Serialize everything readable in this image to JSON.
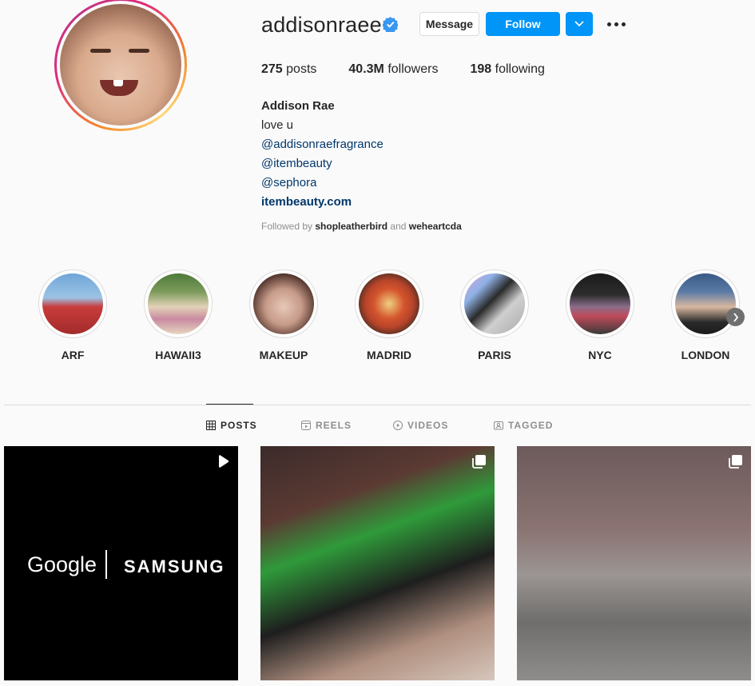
{
  "profile": {
    "username": "addisonraee",
    "verified": true,
    "message_label": "Message",
    "follow_label": "Follow",
    "stats": {
      "posts_count": "275",
      "posts_label": "posts",
      "followers_count": "40.3M",
      "followers_label": "followers",
      "following_count": "198",
      "following_label": "following"
    },
    "bio": {
      "name": "Addison Rae",
      "line1": "love u",
      "tag1": "@addisonraefragrance",
      "tag2": "@itembeauty",
      "tag3": "@sephora",
      "link": "itembeauty.com"
    },
    "followed_by": {
      "prefix": "Followed by",
      "user1": "shopleatherbird",
      "conj": "and",
      "user2": "weheartcda"
    }
  },
  "highlights": [
    {
      "label": "ARF"
    },
    {
      "label": "HAWAII3"
    },
    {
      "label": "MAKEUP"
    },
    {
      "label": "MADRID"
    },
    {
      "label": "PARIS"
    },
    {
      "label": "NYC"
    },
    {
      "label": "LONDON"
    }
  ],
  "tabs": {
    "posts": "POSTS",
    "reels": "REELS",
    "videos": "VIDEOS",
    "tagged": "TAGGED"
  },
  "posts": [
    {
      "text_left": "Google",
      "text_right": "SAMSUNG",
      "icon": "reel-icon"
    },
    {
      "icon": "carousel-icon"
    },
    {
      "icon": "carousel-icon"
    }
  ],
  "colors": {
    "accent": "#0095f6",
    "verified": "#3897f0",
    "link": "#00376b"
  }
}
